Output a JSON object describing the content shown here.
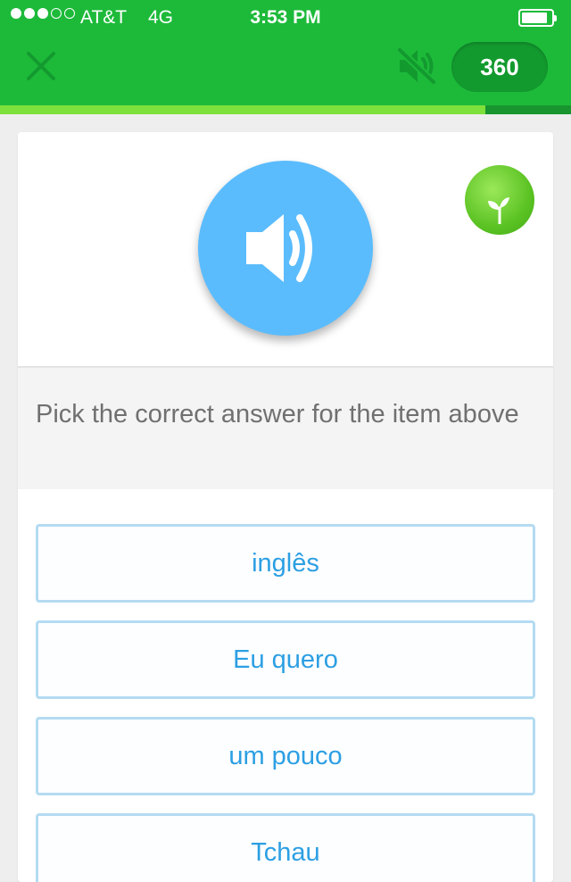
{
  "status_bar": {
    "signal_dots_filled": 3,
    "signal_dots_total": 5,
    "carrier": "AT&T",
    "network": "4G",
    "time": "3:53 PM",
    "battery_icon": "battery-icon"
  },
  "header": {
    "close_icon": "close-icon",
    "mute_icon": "speaker-muted-icon",
    "points": "360",
    "progress_fraction": 0.85,
    "colors": {
      "bar": "#1dba3a",
      "progress": "#7ee03a",
      "points_pill": "#139a2f"
    }
  },
  "card": {
    "audio_button_icon": "speaker-icon",
    "audio_button_color": "#5bbcfd",
    "level_badge_icon": "sprout-icon",
    "prompt": "Pick the correct answer for the item above",
    "options": [
      {
        "label": "inglês"
      },
      {
        "label": "Eu quero"
      },
      {
        "label": "um pouco"
      },
      {
        "label": "Tchau"
      }
    ],
    "option_text_color": "#2c9fe3"
  }
}
